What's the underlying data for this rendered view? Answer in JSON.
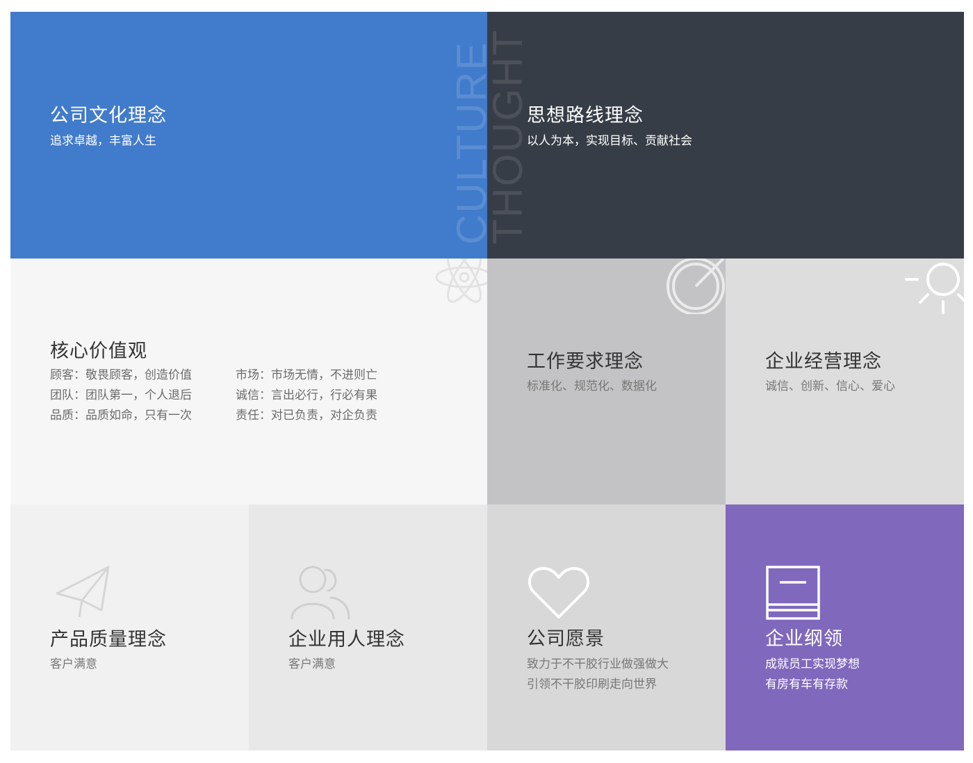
{
  "colors": {
    "culture_bg": "#417bcb",
    "thought_bg": "#373d47",
    "values_bg": "#f6f6f6",
    "work_bg": "#c3c3c5",
    "operation_bg": "#dddddd",
    "quality_bg": "#f1f1f1",
    "employ_bg": "#e8e8e8",
    "vision_bg": "#d8d8d8",
    "program_bg": "#8068bd"
  },
  "watermark": {
    "culture": "CULTURE",
    "thought": "THOUGHT"
  },
  "tiles": {
    "culture": {
      "title": "公司文化理念",
      "subtitle": "追求卓越，丰富人生"
    },
    "thought": {
      "title": "思想路线理念",
      "subtitle": "以人为本，实现目标、贡献社会"
    },
    "values": {
      "title": "核心价值观",
      "items": [
        "顾客：敬畏顾客，创造价值",
        "市场：市场无情，不进则亡",
        "团队：团队第一，个人退后",
        "诚信：言出必行，行必有果",
        "品质：品质如命，只有一次",
        "责任：对已负责，对企负责"
      ]
    },
    "work": {
      "title": "工作要求理念",
      "subtitle": "标准化、规范化、数据化"
    },
    "operation": {
      "title": "企业经营理念",
      "subtitle": "诚信、创新、信心、爱心"
    },
    "quality": {
      "title": "产品质量理念",
      "subtitle": "客户满意",
      "icon": "paper-plane-icon"
    },
    "employ": {
      "title": "企业用人理念",
      "subtitle": "客户满意",
      "icon": "users-icon"
    },
    "vision": {
      "title": "公司愿景",
      "lines": [
        "致力于不干胶行业做强做大",
        "引领不干胶印刷走向世界"
      ],
      "icon": "heart-icon"
    },
    "program": {
      "title": "企业纲领",
      "lines": [
        "成就员工实现梦想",
        "有房有车有存款"
      ],
      "icon": "book-icon"
    }
  }
}
